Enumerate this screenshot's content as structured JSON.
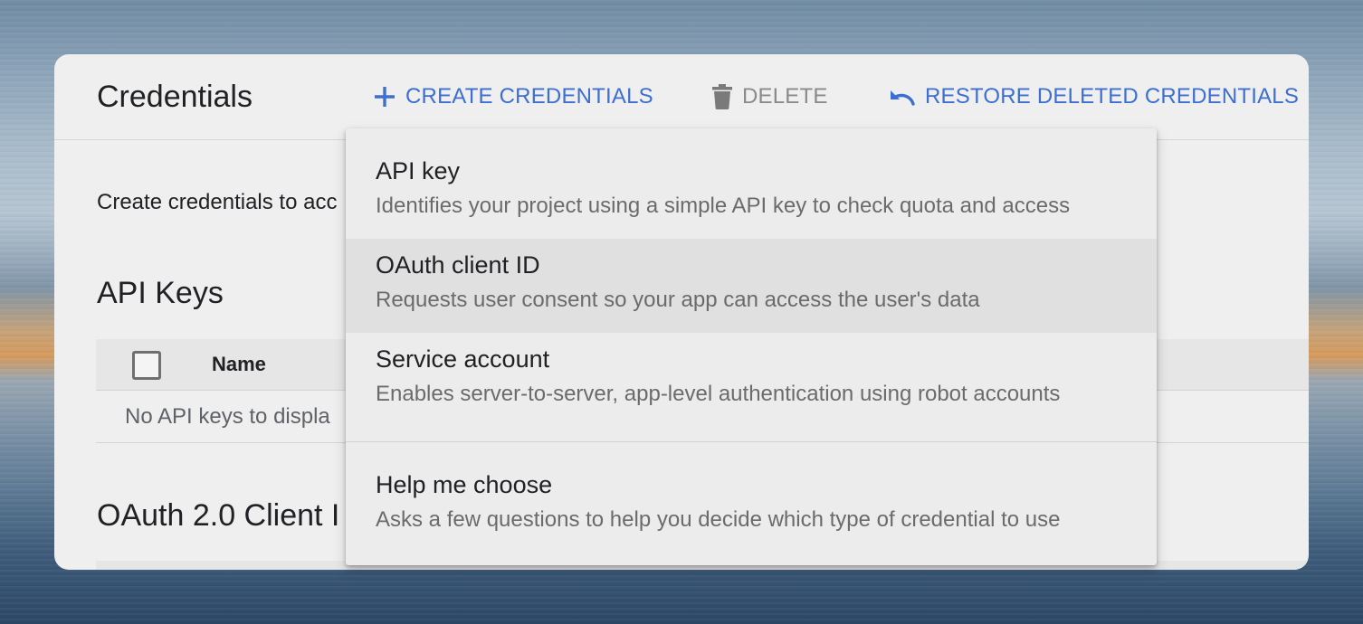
{
  "toolbar": {
    "title": "Credentials",
    "create_label": "CREATE CREDENTIALS",
    "delete_label": "DELETE",
    "restore_label": "RESTORE DELETED CREDENTIALS",
    "accent_color": "#3c6fd0",
    "disabled_color": "#8a8a8a"
  },
  "main": {
    "intro_text": "Create credentials to acc",
    "api_keys_title": "API Keys",
    "api_keys_table": {
      "columns": [
        "Name"
      ],
      "empty_text": "No API keys to displa"
    },
    "oauth_title": "OAuth 2.0 Client I"
  },
  "menu": {
    "items": [
      {
        "title": "API key",
        "description": "Identifies your project using a simple API key to check quota and access"
      },
      {
        "title": "OAuth client ID",
        "description": "Requests user consent so your app can access the user's data",
        "highlighted": true
      },
      {
        "title": "Service account",
        "description": "Enables server-to-server, app-level authentication using robot accounts"
      }
    ],
    "help": {
      "title": "Help me choose",
      "description": "Asks a few questions to help you decide which type of credential to use"
    }
  },
  "icons": {
    "create": "plus-icon",
    "delete": "trash-icon",
    "restore": "undo-icon",
    "checkbox": "checkbox-unchecked"
  }
}
